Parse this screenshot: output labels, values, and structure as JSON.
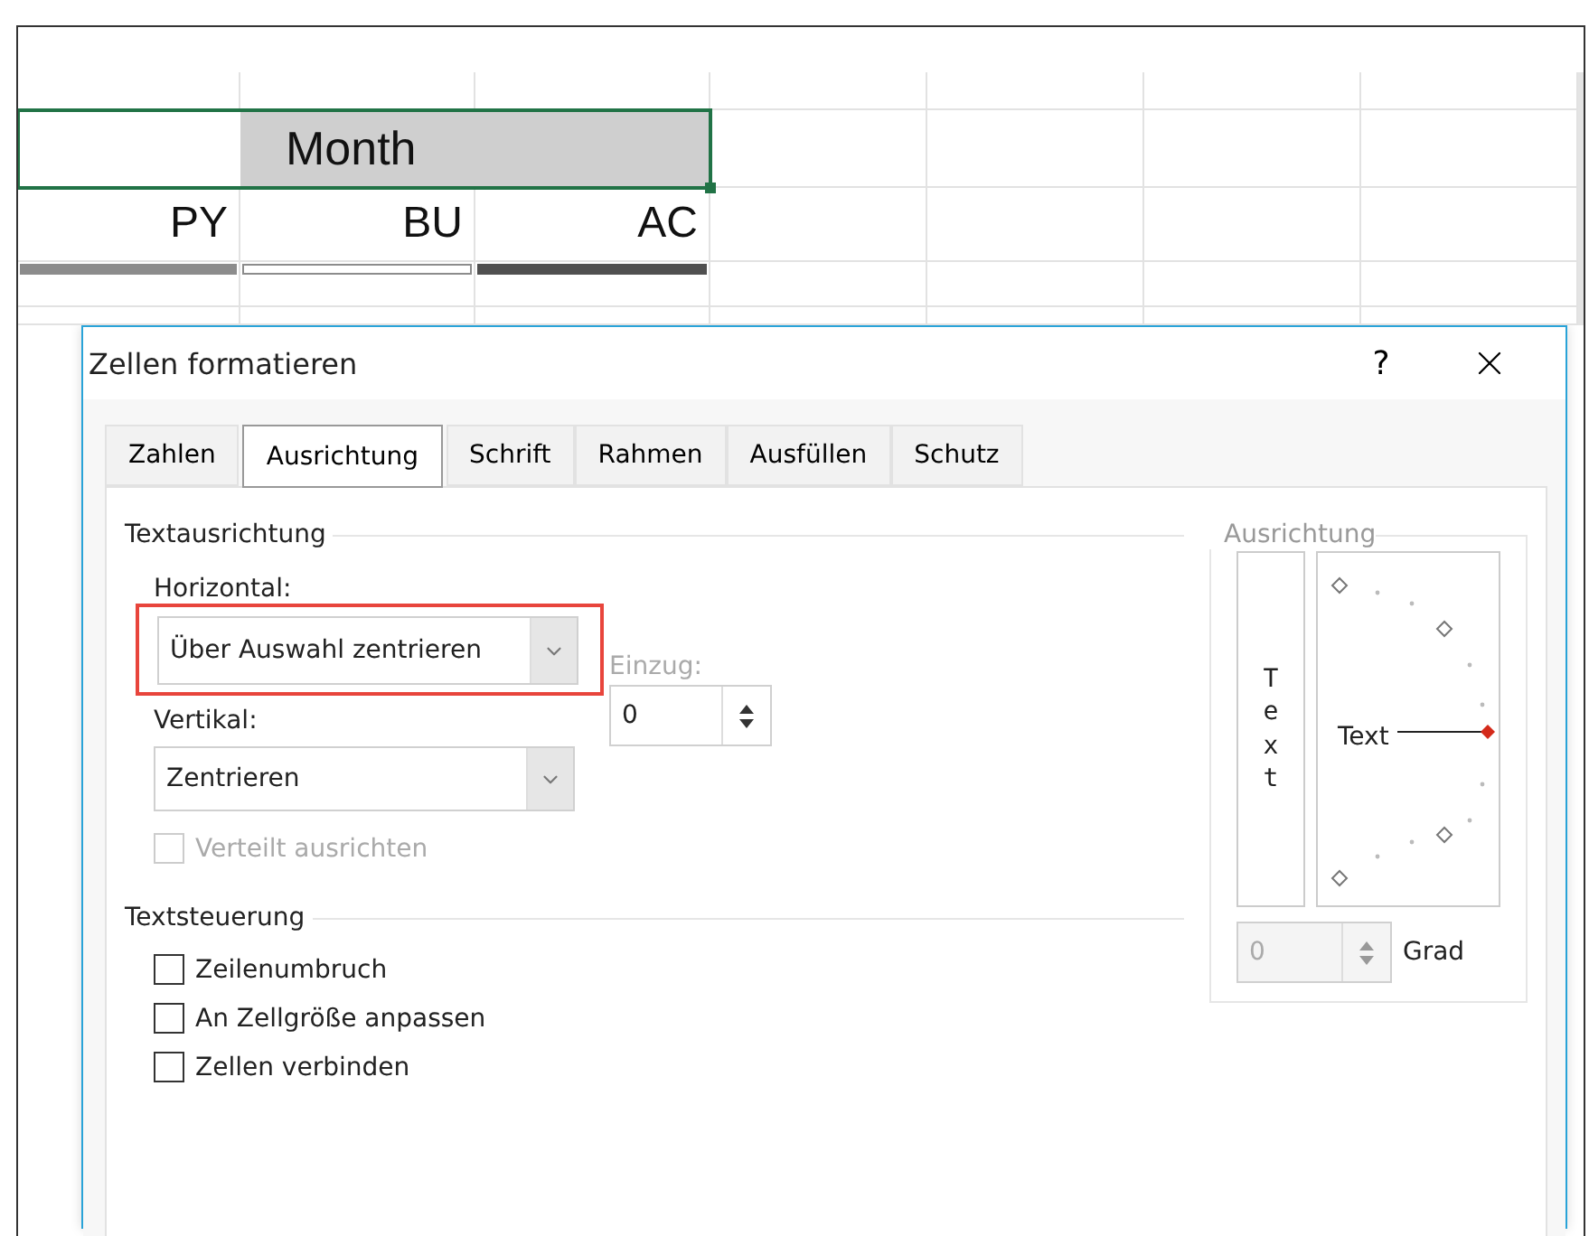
{
  "sheet": {
    "merged_cell": {
      "text": "Month",
      "selected": true
    },
    "headers": [
      "PY",
      "BU",
      "AC"
    ],
    "bars": [
      {
        "kind": "light"
      },
      {
        "kind": "outline"
      },
      {
        "kind": "dark"
      }
    ]
  },
  "dialog": {
    "title": "Zellen formatieren",
    "help": "?",
    "tabs": [
      {
        "label": "Zahlen",
        "selected": false
      },
      {
        "label": "Ausrichtung",
        "selected": true
      },
      {
        "label": "Schrift",
        "selected": false
      },
      {
        "label": "Rahmen",
        "selected": false
      },
      {
        "label": "Ausfüllen",
        "selected": false
      },
      {
        "label": "Schutz",
        "selected": false
      }
    ],
    "text_alignment": {
      "title": "Textausrichtung",
      "horizontal": {
        "label": "Horizontal:",
        "value": "Über Auswahl zentrieren",
        "highlighted": true
      },
      "indent": {
        "label": "Einzug:",
        "value": "0"
      },
      "vertical": {
        "label": "Vertikal:",
        "value": "Zentrieren"
      },
      "distributed": {
        "label": "Verteilt ausrichten",
        "checked": false,
        "disabled": true
      }
    },
    "text_control": {
      "title": "Textsteuerung",
      "options": [
        {
          "label": "Zeilenumbruch",
          "checked": false,
          "disabled": false
        },
        {
          "label": "An Zellgröße anpassen",
          "checked": false,
          "disabled": false
        },
        {
          "label": "Zellen verbinden",
          "checked": false,
          "disabled": false
        }
      ]
    },
    "orientation": {
      "title": "Ausrichtung",
      "vertical_text": "Text",
      "dial_label": "Text",
      "degrees": {
        "value": "0",
        "label": "Grad",
        "disabled": true
      }
    }
  }
}
